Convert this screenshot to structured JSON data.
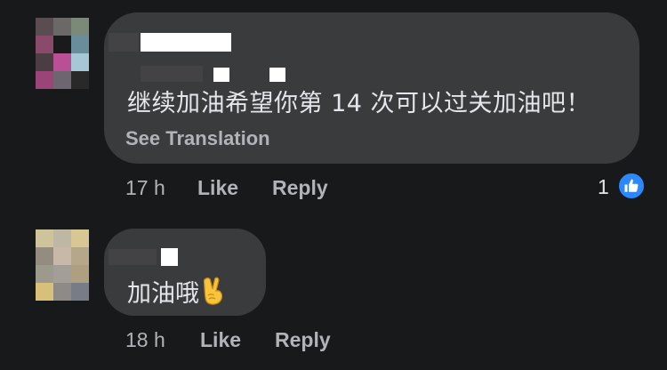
{
  "comments": [
    {
      "text": "继续加油希望你第 14 次可以过关加油吧！",
      "see_translation": "See Translation",
      "time": "17 h",
      "like": "Like",
      "reply": "Reply",
      "reaction_count": "1",
      "reaction_icon": "thumbs-up-icon",
      "avatar_colors": [
        "#5a4d52",
        "#6b6868",
        "#7b8a78",
        "#8a4a6a",
        "#1a1a1a",
        "#6a8d9b",
        "#4b3e42",
        "#b94f95",
        "#a5c7d6",
        "#9a4478",
        "#6d6671",
        "#292929"
      ]
    },
    {
      "text": "加油哦",
      "emoji": "victory-hand-emoji",
      "time": "18 h",
      "like": "Like",
      "reply": "Reply",
      "avatar_colors": [
        "#cfc39c",
        "#bdb7a4",
        "#d6c794",
        "#948c7f",
        "#c8b8a8",
        "#b5a88a",
        "#9b9a8c",
        "#a39e98",
        "#ad9f80",
        "#d9c07a",
        "#8e8a86",
        "#777c86"
      ]
    }
  ],
  "colors": {
    "background": "#18191a",
    "bubble": "#3a3b3c",
    "text_primary": "#e4e6eb",
    "text_secondary": "#b0b3b8",
    "like_blue": "#2d88ff"
  }
}
